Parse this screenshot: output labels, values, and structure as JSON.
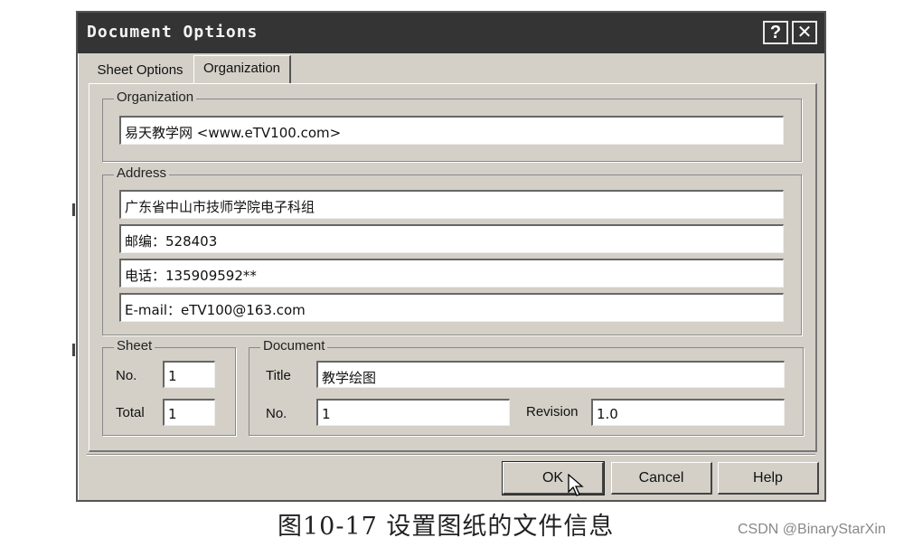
{
  "window": {
    "title": "Document Options",
    "help_glyph": "?",
    "close_glyph": "✕"
  },
  "tabs": [
    {
      "label": "Sheet Options",
      "active": false
    },
    {
      "label": "Organization",
      "active": true
    }
  ],
  "organization": {
    "group_label": "Organization",
    "name": "易天教学网 <www.eTV100.com>"
  },
  "address": {
    "group_label": "Address",
    "lines": [
      "广东省中山市技师学院电子科组",
      "邮编：528403",
      "电话：135909592**",
      "E-mail：eTV100@163.com"
    ]
  },
  "sheet": {
    "group_label": "Sheet",
    "no_label": "No.",
    "no_value": "1",
    "total_label": "Total",
    "total_value": "1"
  },
  "document": {
    "group_label": "Document",
    "title_label": "Title",
    "title_value": "教学绘图",
    "no_label": "No.",
    "no_value": "1",
    "revision_label": "Revision",
    "revision_value": "1.0"
  },
  "buttons": {
    "ok": "OK",
    "cancel": "Cancel",
    "help": "Help"
  },
  "caption": "图10-17 设置图纸的文件信息",
  "watermark": "CSDN @BinaryStarXin",
  "colors": {
    "titlebar": "#343434",
    "dialog_bg": "#d4d0c8",
    "field_bg": "#ffffff"
  }
}
